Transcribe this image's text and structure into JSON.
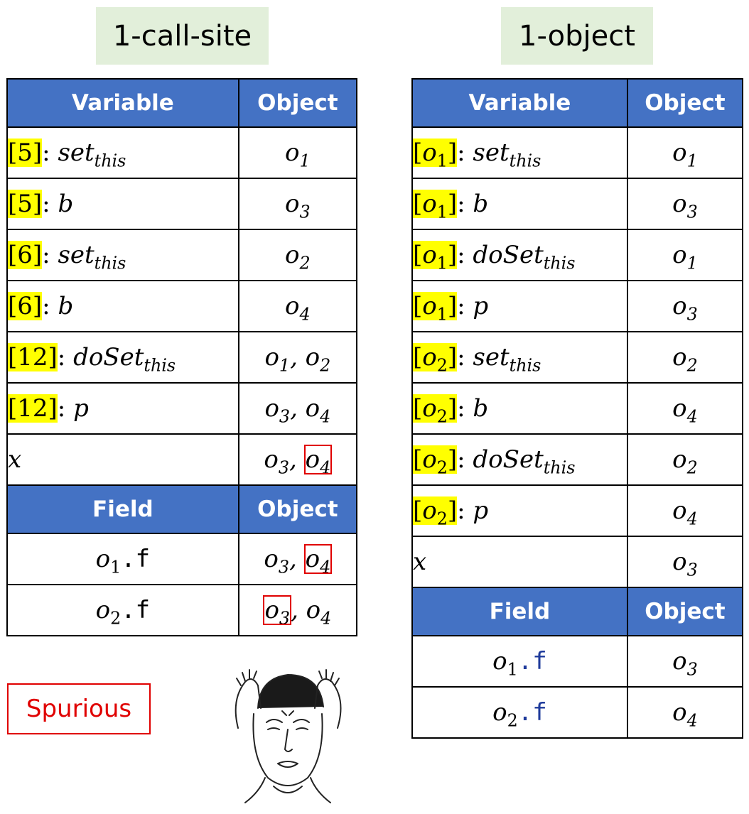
{
  "left": {
    "title": "1-call-site",
    "header": {
      "variable": "Variable",
      "object": "Object"
    },
    "rows": [
      {
        "ctx": "[5]",
        "name": "set",
        "sub": "this",
        "objs": [
          "o1"
        ]
      },
      {
        "ctx": "[5]",
        "name": "b",
        "sub": "",
        "objs": [
          "o3"
        ]
      },
      {
        "ctx": "[6]",
        "name": "set",
        "sub": "this",
        "objs": [
          "o2"
        ]
      },
      {
        "ctx": "[6]",
        "name": "b",
        "sub": "",
        "objs": [
          "o4"
        ]
      },
      {
        "ctx": "[12]",
        "name": "doSet",
        "sub": "this",
        "objs": [
          "o1",
          "o2"
        ]
      },
      {
        "ctx": "[12]",
        "name": "p",
        "sub": "",
        "objs": [
          "o3",
          "o4"
        ]
      },
      {
        "ctx": "",
        "name": "x",
        "sub": "",
        "objs": [
          "o3",
          "o4"
        ],
        "boxed": [
          1
        ]
      }
    ],
    "field_header": {
      "field": "Field",
      "object": "Object"
    },
    "field_rows": [
      {
        "field": "o1.f",
        "objs": [
          "o3",
          "o4"
        ],
        "boxed": [
          1
        ]
      },
      {
        "field": "o2.f",
        "objs": [
          "o3",
          "o4"
        ],
        "boxed": [
          0
        ]
      }
    ]
  },
  "right": {
    "title": "1-object",
    "header": {
      "variable": "Variable",
      "object": "Object"
    },
    "rows": [
      {
        "ctx": "o1",
        "name": "set",
        "sub": "this",
        "objs": [
          "o1"
        ]
      },
      {
        "ctx": "o1",
        "name": "b",
        "sub": "",
        "objs": [
          "o3"
        ]
      },
      {
        "ctx": "o1",
        "name": "doSet",
        "sub": "this",
        "objs": [
          "o1"
        ]
      },
      {
        "ctx": "o1",
        "name": "p",
        "sub": "",
        "objs": [
          "o3"
        ]
      },
      {
        "ctx": "o2",
        "name": "set",
        "sub": "this",
        "objs": [
          "o2"
        ]
      },
      {
        "ctx": "o2",
        "name": "b",
        "sub": "",
        "objs": [
          "o4"
        ]
      },
      {
        "ctx": "o2",
        "name": "doSet",
        "sub": "this",
        "objs": [
          "o2"
        ]
      },
      {
        "ctx": "o2",
        "name": "p",
        "sub": "",
        "objs": [
          "o4"
        ]
      },
      {
        "ctx": "",
        "name": "x",
        "sub": "",
        "objs": [
          "o3"
        ]
      }
    ],
    "field_header": {
      "field": "Field",
      "object": "Object"
    },
    "field_rows": [
      {
        "field": "o1.f",
        "objs": [
          "o3"
        ]
      },
      {
        "field": "o2.f",
        "objs": [
          "o4"
        ]
      }
    ]
  },
  "spurious_label": "Spurious",
  "colors": {
    "header_bg": "#4472c4",
    "title_bg": "#e2efda",
    "highlight": "#ffff00",
    "alert": "#e00000"
  },
  "icons": {
    "face": "confused-face-meme-icon"
  }
}
